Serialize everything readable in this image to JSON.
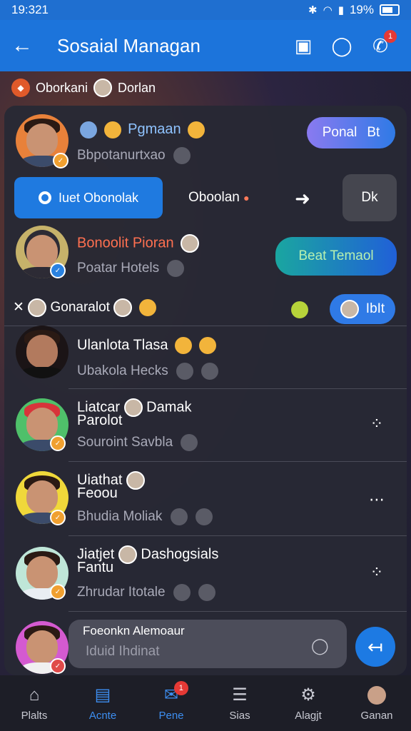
{
  "status": {
    "time": "19:321",
    "battery": "19%"
  },
  "appbar": {
    "title": "Sosaial Managan"
  },
  "crumb": {
    "left": "Oborkani",
    "right": "Dorlan"
  },
  "card1": {
    "name": "Pgmaan",
    "sub": "Bbpotanurtxao",
    "pill": "Ponal",
    "pill_right": "Bt"
  },
  "actions": {
    "primary": "Iuet Obonolak",
    "secondary": "Oboolan",
    "end": "Dk"
  },
  "card2": {
    "name": "Bonoolit Pioran",
    "sub": "Poatar Hotels",
    "pill": "Beat Temaol"
  },
  "section": {
    "title": "Gonaralot",
    "pill": "IbIt"
  },
  "contacts": [
    {
      "name": "Ulanlota Tlasa",
      "sub": "Ubakola Hecks"
    },
    {
      "name": "Liatcar",
      "name2": "Damak",
      "name3": "Parolot",
      "sub": "Souroint Savbla"
    },
    {
      "name": "Uiathat",
      "name3": "Feoou",
      "sub": "Bhudia Moliak"
    },
    {
      "name": "Jiatjet",
      "name2": "Dashogsials",
      "name3": "Fantu",
      "sub": "Zhrudar Itotale"
    }
  ],
  "composer": {
    "label": "Foeonkn Alemoaur",
    "placeholder": "Iduid Ihdinat"
  },
  "nav": {
    "items": [
      "Plalts",
      "Acnte",
      "Pene",
      "Sias",
      "Alagjt",
      "Ganan"
    ]
  }
}
